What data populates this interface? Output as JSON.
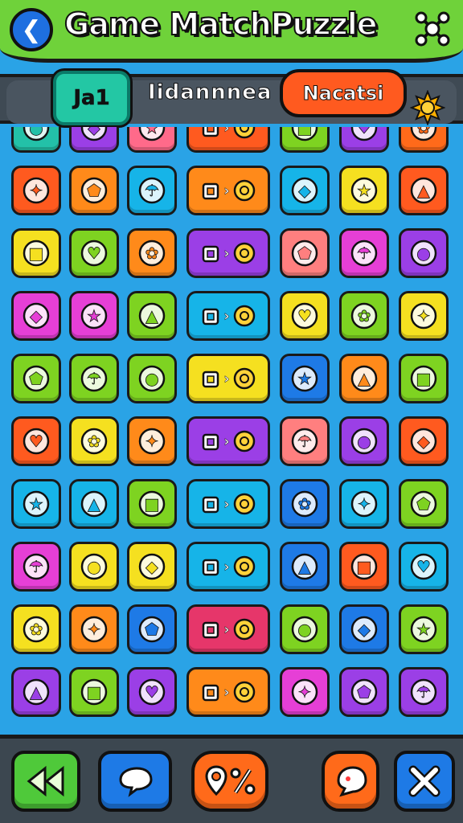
{
  "header": {
    "title": "Game MatchPuzzle",
    "back_icon": "back-arrow-icon",
    "menu_icon": "network-nodes-icon"
  },
  "status": {
    "level_label": "Ja1",
    "mode_label": "Iidannnea",
    "mode_pill": "Nacatsi",
    "weather_icon": "sun-icon"
  },
  "board": {
    "rows": [
      [
        "block-icon",
        "key-icon",
        "cherry-icon",
        "crate-pair-icon",
        "ring-icon",
        "frog-icon",
        "snail-icon"
      ],
      [
        "search-icon",
        "palm-tree-icon",
        "vault-icon",
        "chest-to-note-icon",
        "monitor-icon",
        "puzzle-box-icon",
        "rocket-icon"
      ],
      [
        "crayon-icon",
        "present-icon",
        "skull-icon",
        "house-to-clock-icon",
        "turtle-icon",
        "gem-icon",
        "cloud-cow-icon"
      ],
      [
        "gear-sun-icon",
        "cube-icon",
        "forest-icon",
        "house-to-spiral-icon",
        "ring-icon",
        "globe-icon",
        "turtle-icon"
      ],
      [
        "ribbon-icon",
        "cake-icon",
        "potato-icon",
        "box-to-orb-icon",
        "ghost-icon",
        "dog-icon",
        "plug-icon"
      ],
      [
        "pencil-icon",
        "gem-icon",
        "tree-frame-icon",
        "plant-to-monitor-icon",
        "hedgehog-icon",
        "crayon-icon",
        "bird-icon"
      ],
      [
        "duck-icon",
        "bird-icon",
        "sun-flower-icon",
        "key-to-spiral-icon",
        "rocket-icon",
        "palm-crate-icon",
        "chest-icon"
      ],
      [
        "bones-icon",
        "cage-icon",
        "knife-icon",
        "jar-to-rabbit-icon",
        "crab-icon",
        "fish-icon",
        "sun-icon"
      ],
      [
        "note-icon",
        "book-icon",
        "heart-icon",
        "frame-to-gear-icon",
        "spoon-icon",
        "onion-icon",
        "calendar-icon"
      ],
      [
        "cat-icon",
        "heart-icon",
        "chat-icon",
        "leaf-to-bird-icon",
        "radio-icon",
        "palm-tree-icon",
        "duck-icon"
      ]
    ],
    "colors": {
      "rows": [
        [
          "#23c1a8",
          "#9b3fe6",
          "#ff6a8a",
          "#ff5a1f",
          "#7ed321",
          "#9b3fe6",
          "#ff6a1a"
        ],
        [
          "#ff5a1f",
          "#ff8a1a",
          "#16b4e8",
          "#ff8a1a",
          "#16b4e8",
          "#f5e020",
          "#ff5a1f"
        ],
        [
          "#f5e020",
          "#7ed321",
          "#ff8a1a",
          "#9b3fe6",
          "#ff7f7f",
          "#e63fd6",
          "#9b3fe6"
        ],
        [
          "#e63fd6",
          "#e63fd6",
          "#7ed321",
          "#16b4e8",
          "#f5e020",
          "#7ed321",
          "#f5e020"
        ],
        [
          "#7ed321",
          "#7ed321",
          "#7ed321",
          "#f5e020",
          "#1e7ae6",
          "#ff8a1a",
          "#7ed321"
        ],
        [
          "#ff5a1f",
          "#f5e020",
          "#ff8a1a",
          "#9b3fe6",
          "#ff7f7f",
          "#9b3fe6",
          "#ff5a1f"
        ],
        [
          "#16b4e8",
          "#16b4e8",
          "#7ed321",
          "#16b4e8",
          "#1e7ae6",
          "#16b4e8",
          "#7ed321"
        ],
        [
          "#e63fd6",
          "#f5e020",
          "#f5e020",
          "#16b4e8",
          "#1e7ae6",
          "#ff5a1f",
          "#16b4e8"
        ],
        [
          "#f5e020",
          "#ff8a1a",
          "#1e7ae6",
          "#e6366a",
          "#7ed321",
          "#1e7ae6",
          "#7ed321"
        ],
        [
          "#9b3fe6",
          "#7ed321",
          "#9b3fe6",
          "#ff8a1a",
          "#e63fd6",
          "#9b3fe6",
          "#9b3fe6"
        ]
      ]
    }
  },
  "bottom": {
    "buttons": [
      {
        "icon": "rewind-icon",
        "color": "#4fc93a"
      },
      {
        "icon": "chat-bubble-icon",
        "color": "#1e7ae6"
      },
      {
        "icon": "location-percent-icon",
        "color": "#ff6a1a"
      },
      {
        "icon": "speech-icon",
        "color": "#ff6a1a"
      },
      {
        "icon": "close-icon",
        "color": "#1e7ae6"
      }
    ]
  }
}
